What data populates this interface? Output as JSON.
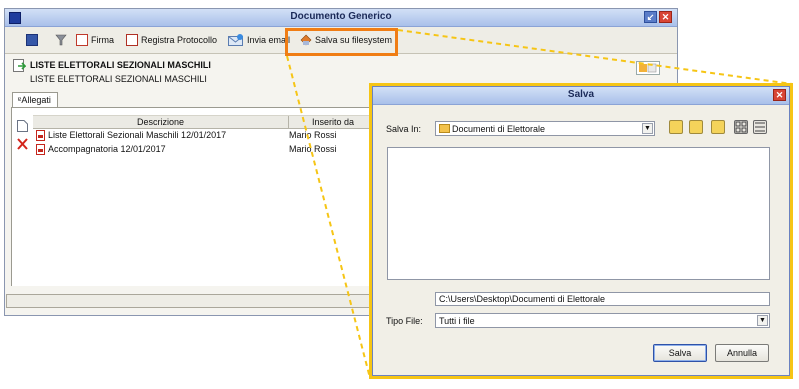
{
  "main_window": {
    "title": "Documento Generico",
    "toolbar": {
      "firma": "Firma",
      "registra_protocollo": "Registra Protocollo",
      "invia_email": "Invia email",
      "salva_su_filesystem": "Salva su filesystem"
    },
    "document": {
      "title": "LISTE ELETTORALI SEZIONALI MASCHILI",
      "subtitle": "LISTE ELETTORALI SEZIONALI MASCHILI"
    },
    "tab_label": "Allegati",
    "grid": {
      "columns": [
        "Descrizione",
        "Inserito da"
      ],
      "rows": [
        {
          "descrizione": "Liste Elettorali Sezionali Maschili  12/01/2017",
          "inserito_da": "Mario Rossi"
        },
        {
          "descrizione": "Accompagnatoria 12/01/2017",
          "inserito_da": "Mario Rossi"
        }
      ]
    }
  },
  "dialog": {
    "title": "Salva",
    "salva_in_label": "Salva In:",
    "salva_in_value": "Documenti di Elettorale",
    "path_value": "C:\\Users\\Desktop\\Documenti di Elettorale",
    "tipo_file_label": "Tipo File:",
    "tipo_file_value": "Tutti i file",
    "salva_button": "Salva",
    "annulla_button": "Annulla"
  },
  "colors": {
    "highlight": "#f07d14",
    "dialog_border": "#f6c515",
    "titlebar": "#a9c0ea"
  }
}
